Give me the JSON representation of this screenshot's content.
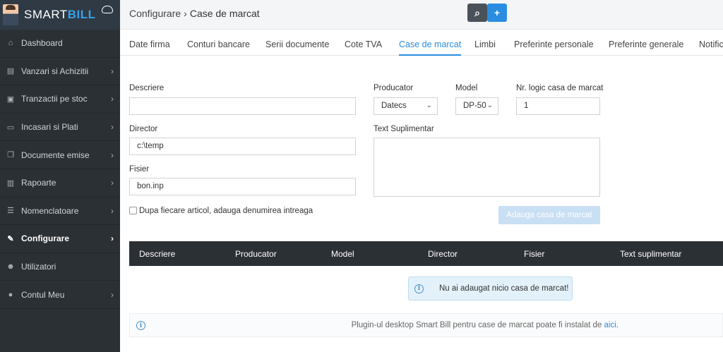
{
  "brand": {
    "logo_part1": "SMART",
    "logo_part2": "BILL"
  },
  "sidebar": {
    "items": [
      {
        "label": "Dashboard",
        "icon": "home-icon",
        "glyph": "⌂"
      },
      {
        "label": "Vanzari si Achizitii",
        "icon": "cart-icon",
        "glyph": "▤"
      },
      {
        "label": "Tranzactii pe stoc",
        "icon": "stock-icon",
        "glyph": "▣"
      },
      {
        "label": "Incasari si Plati",
        "icon": "money-icon",
        "glyph": "▭"
      },
      {
        "label": "Documente emise",
        "icon": "documents-icon",
        "glyph": "❐"
      },
      {
        "label": "Rapoarte",
        "icon": "chart-icon",
        "glyph": "▥"
      },
      {
        "label": "Nomenclatoare",
        "icon": "list-icon",
        "glyph": "☰"
      },
      {
        "label": "Configurare",
        "icon": "wrench-icon",
        "glyph": "✎"
      },
      {
        "label": "Utilizatori",
        "icon": "users-icon",
        "glyph": "☻"
      },
      {
        "label": "Contul Meu",
        "icon": "user-icon",
        "glyph": "●"
      }
    ],
    "chevron": "›"
  },
  "header": {
    "breadcrumb_parent": "Configurare",
    "breadcrumb_sep": "›",
    "breadcrumb_current": "Case de marcat",
    "search_glyph": "⌕",
    "add_glyph": "+"
  },
  "tabs": [
    "Date firma",
    "Conturi bancare",
    "Serii documente",
    "Cote TVA",
    "Case de marcat",
    "Limbi",
    "Preferinte personale",
    "Preferinte generale",
    "Notific"
  ],
  "form": {
    "descriere_label": "Descriere",
    "descriere_value": "",
    "producator_label": "Producator",
    "producator_value": "Datecs",
    "model_label": "Model",
    "model_value": "DP-50",
    "nr_logic_label": "Nr. logic casa de marcat",
    "nr_logic_value": "1",
    "director_label": "Director",
    "director_value": "c:\\temp",
    "text_sup_label": "Text Suplimentar",
    "text_sup_value": "",
    "fisier_label": "Fisier",
    "fisier_value": "bon.inp",
    "checkbox_label": "Dupa fiecare articol, adauga denumirea intreaga",
    "add_button": "Adauga casa de marcat"
  },
  "table": {
    "headers": [
      "Descriere",
      "Producator",
      "Model",
      "Director",
      "Fisier",
      "Text suplimentar"
    ],
    "empty_message": "Nu ai adaugat nicio casa de marcat!"
  },
  "plugin": {
    "text": "Plugin-ul desktop Smart Bill pentru case de marcat poate fi instalat de ",
    "link": "aici",
    "suffix": "."
  },
  "colors": {
    "sidebar_bg": "#2b3035",
    "accent": "#2a8de0",
    "active_tab": "#2a8de0"
  }
}
